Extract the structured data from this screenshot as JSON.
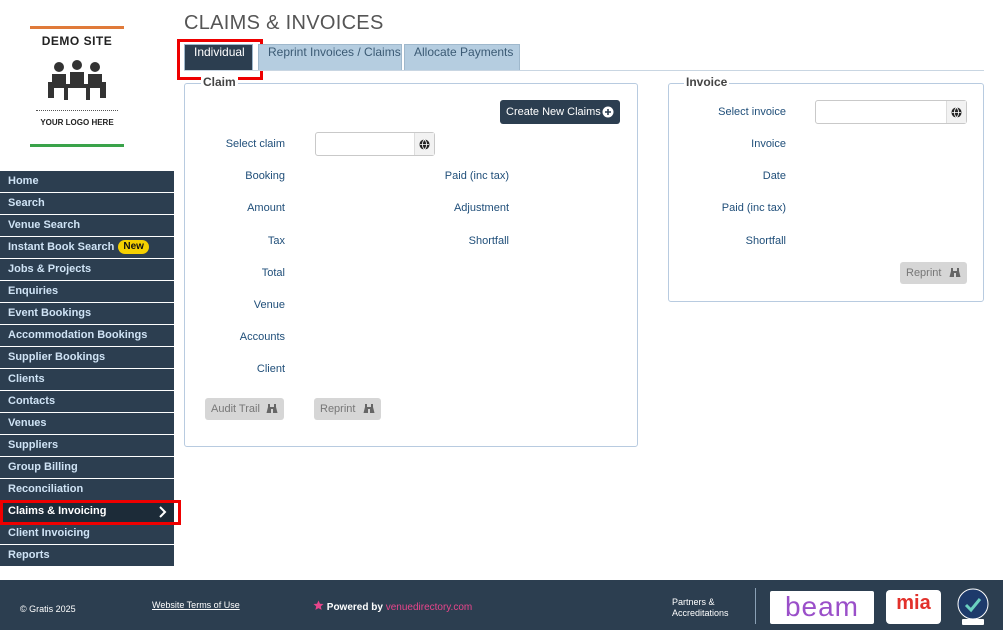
{
  "logo": {
    "title": "DEMO SITE",
    "subtitle": "YOUR LOGO HERE"
  },
  "sidebar": {
    "items": [
      {
        "label": "Home"
      },
      {
        "label": "Search"
      },
      {
        "label": "Venue Search"
      },
      {
        "label": "Instant Book Search",
        "badge": "New"
      },
      {
        "label": "Jobs & Projects"
      },
      {
        "label": "Enquiries"
      },
      {
        "label": "Event Bookings"
      },
      {
        "label": "Accommodation Bookings"
      },
      {
        "label": "Supplier Bookings"
      },
      {
        "label": "Clients"
      },
      {
        "label": "Contacts"
      },
      {
        "label": "Venues"
      },
      {
        "label": "Suppliers"
      },
      {
        "label": "Group Billing"
      },
      {
        "label": "Reconciliation"
      },
      {
        "label": "Claims & Invoicing",
        "active": true
      },
      {
        "label": "Client Invoicing"
      },
      {
        "label": "Reports"
      }
    ]
  },
  "page": {
    "title": "CLAIMS & INVOICES"
  },
  "tabs": [
    {
      "label": "Individual",
      "active": true
    },
    {
      "label": "Reprint Invoices / Claims"
    },
    {
      "label": "Allocate Payments"
    }
  ],
  "claim": {
    "legend": "Claim",
    "create_button": "Create New Claims",
    "select_label": "Select claim",
    "select_value": "",
    "left_labels": [
      "Booking",
      "Amount",
      "Tax",
      "Total",
      "Venue",
      "Accounts",
      "Client"
    ],
    "right_labels": [
      "Paid (inc tax)",
      "Adjustment",
      "Shortfall"
    ],
    "audit_button": "Audit Trail",
    "reprint_button": "Reprint"
  },
  "invoice": {
    "legend": "Invoice",
    "select_label": "Select invoice",
    "select_value": "",
    "labels": [
      "Invoice",
      "Date",
      "Paid (inc tax)",
      "Shortfall"
    ],
    "reprint_button": "Reprint"
  },
  "footer": {
    "copyright": "© Gratis 2025",
    "terms_link": "Website Terms of Use",
    "powered_by": "Powered by",
    "powered_brand": "venuedirectory.com",
    "partners": [
      "Partners &",
      "Accreditations"
    ],
    "beam_logo": "beam",
    "mia_logo": "mia"
  },
  "colors": {
    "nav_bg": "#2c3e50",
    "accent_red": "#e00000",
    "brand_pink": "#e8458b"
  },
  "icons": [
    "people-icon",
    "globe-icon",
    "plus-circle-icon",
    "binoculars-icon",
    "chevron-right-icon",
    "star-icon",
    "cyber-essentials-badge"
  ]
}
